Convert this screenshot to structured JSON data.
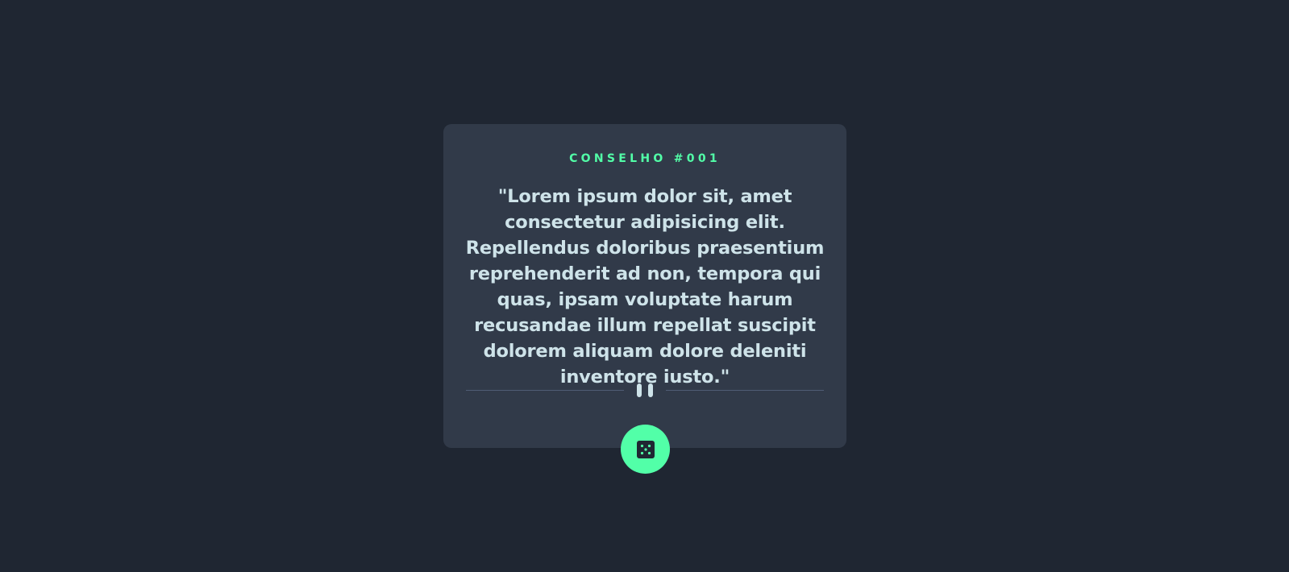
{
  "advice": {
    "label": "CONSELHO #001",
    "quote": "\"Lorem ipsum dolor sit, amet consectetur adipisicing elit. Repellendus doloribus praesentium reprehenderit ad non, tempora qui quas, ipsam voluptate harum recusandae illum repellat suscipit dolorem aliquam dolore deleniti inventore iusto.\""
  },
  "icons": {
    "divider": "pause-icon",
    "button": "dice-icon"
  },
  "colors": {
    "background": "#1f2632",
    "card": "#313a49",
    "accent": "#52ffa8",
    "text": "#cee3e9",
    "divider": "#4f5d74"
  }
}
